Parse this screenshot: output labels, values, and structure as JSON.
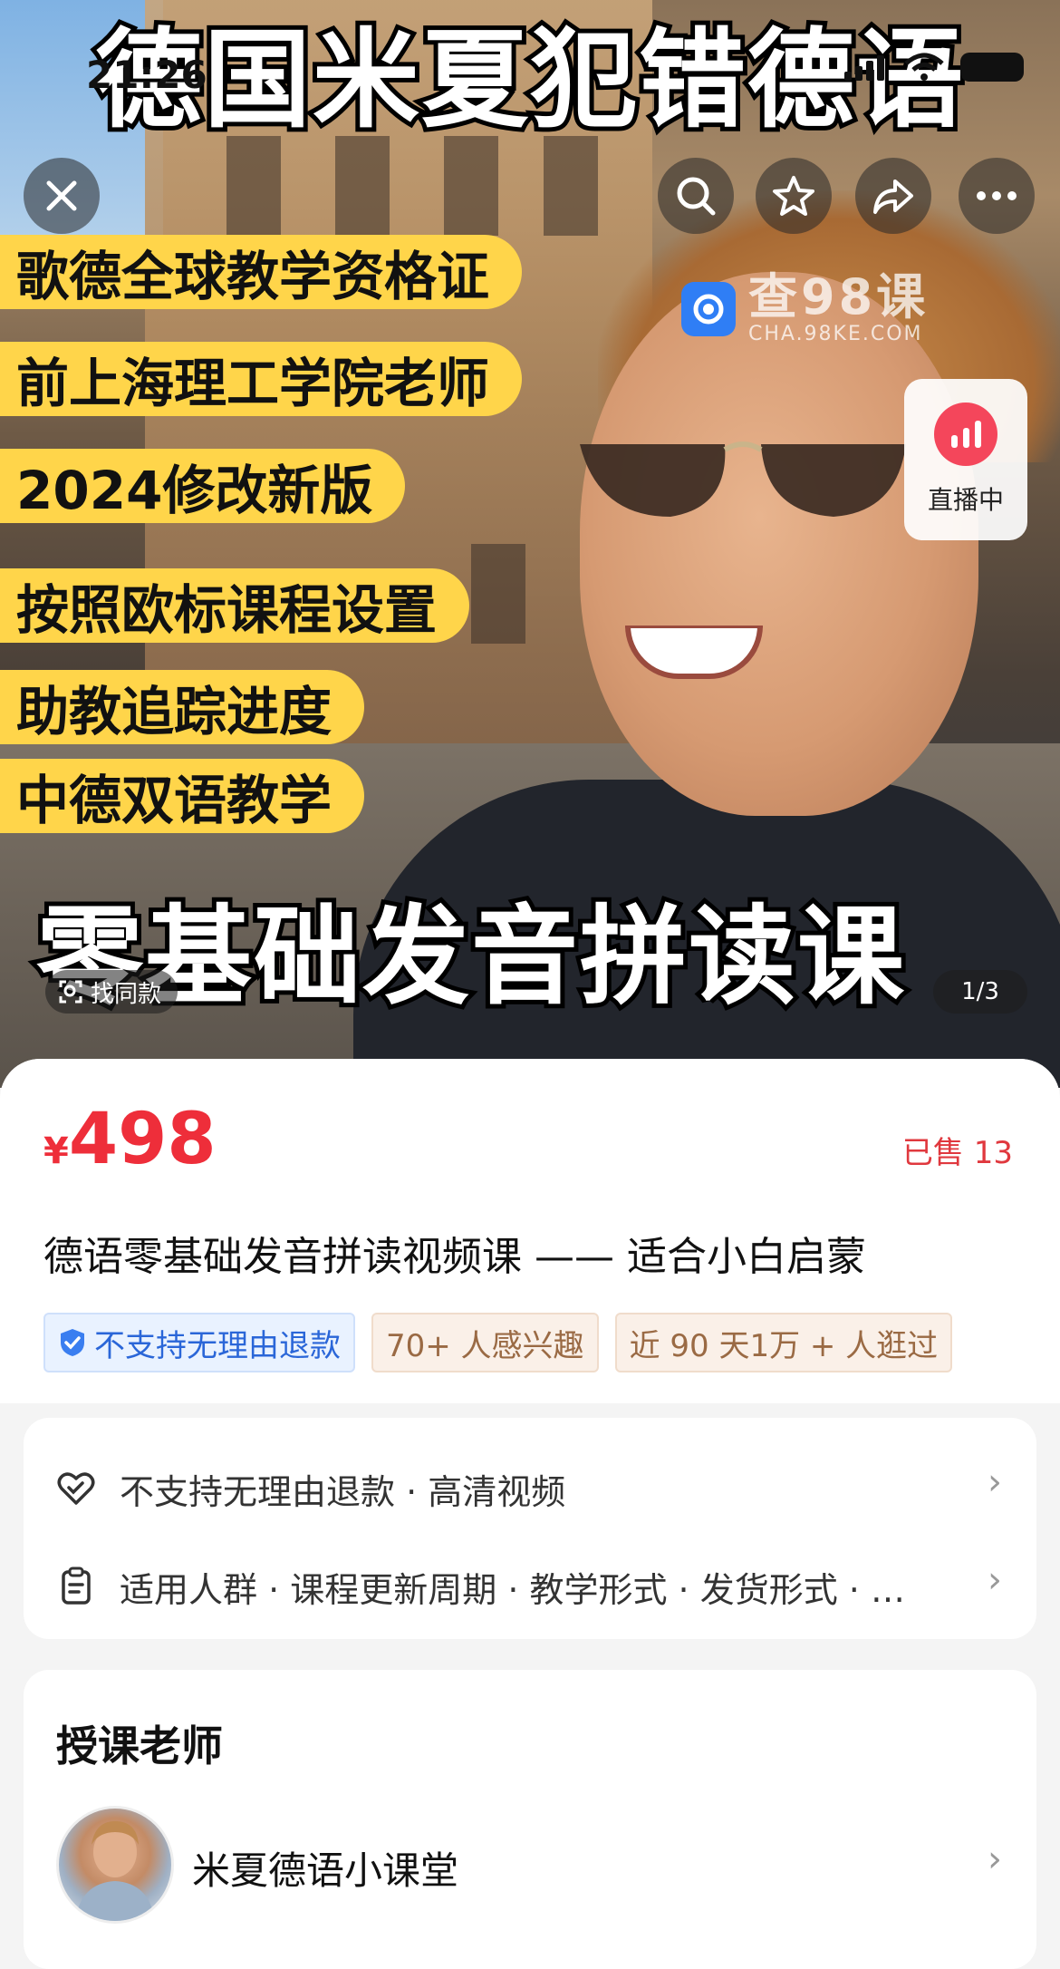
{
  "status_bar": {
    "time": "21:26"
  },
  "hero": {
    "title_overlay": "德国米夏犯错德语",
    "bottom_overlay": "零基础发音拼读课",
    "promo_tags": [
      "歌德全球教学资格证",
      "前上海理工学院老师",
      "2024修改新版",
      "按照欧标课程设置",
      "助教追踪进度",
      "中德双语教学"
    ],
    "watermark_text": "查98课",
    "watermark_sub": "CHA.98KE.COM",
    "live_label": "直播中",
    "find_same_label": "找同款",
    "page_indicator": "1/3",
    "icons": [
      "close-icon",
      "search-icon",
      "star-icon",
      "share-icon",
      "more-icon"
    ]
  },
  "product": {
    "currency": "¥",
    "price": "498",
    "sold": "已售 13",
    "title": "德语零基础发音拼读视频课 —— 适合小白启蒙",
    "chips": [
      "不支持无理由退款",
      "70+ 人感兴趣",
      "近 90 天1万 + 人逛过"
    ]
  },
  "info": {
    "row1": "不支持无理由退款 · 高清视频",
    "row2": "适用人群 · 课程更新周期 · 教学形式 · 发货形式 · …"
  },
  "teacher": {
    "section_title": "授课老师",
    "name": "米夏德语小课堂"
  },
  "colors": {
    "price_red": "#ee2e3a",
    "tag_yellow": "#ffd54a",
    "live_pink": "#f4465b"
  }
}
